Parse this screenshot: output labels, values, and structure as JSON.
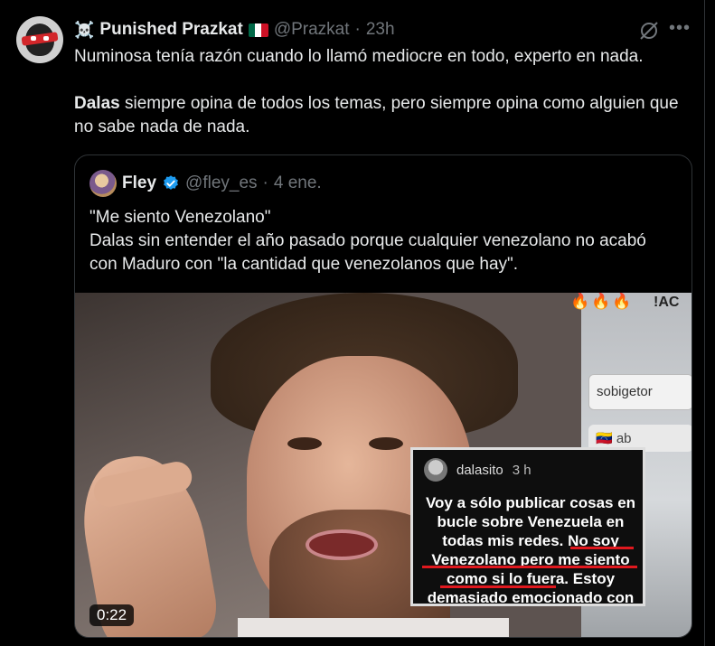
{
  "tweet": {
    "display_name": "Punished Prazkat",
    "name_prefix_icon": "☠️",
    "flag_icon": "mexico-flag",
    "handle": "@Prazkat",
    "separator": "·",
    "time": "23h",
    "text_line1": "Numinosa tenía razón cuando lo llamó mediocre en todo, experto en nada.",
    "text_bold": "Dalas",
    "text_line2": " siempre opina de todos los temas, pero siempre opina como alguien que no sabe nada de nada."
  },
  "quote": {
    "display_name": "Fley",
    "handle": "@fley_es",
    "separator": "·",
    "date": "4 ene.",
    "text_line1": "\"Me siento Venezolano\"",
    "text_line2": "Dalas sin entender el año pasado porque cualquier venezolano no acabó con Maduro con \"la cantidad que venezolanos que hay\"."
  },
  "media": {
    "duration": "0:22",
    "story_user": "dalasito",
    "story_time": "3 h",
    "story_text_a": "Voy a sólo publicar cosas en bucle sobre Venezuela en todas mis redes. ",
    "story_text_b": "No soy Venezolano pero me siento como si lo fuera.",
    "story_text_c": " Estoy demasiado emocionado con"
  },
  "icons": {
    "grok": "grok-icon",
    "more": "more-icon",
    "verified": "verified-badge-icon"
  },
  "colors": {
    "background": "#000000",
    "text": "#e7e9ea",
    "muted": "#71767b",
    "verified": "#1d9bf0",
    "underline": "#e0181e"
  }
}
